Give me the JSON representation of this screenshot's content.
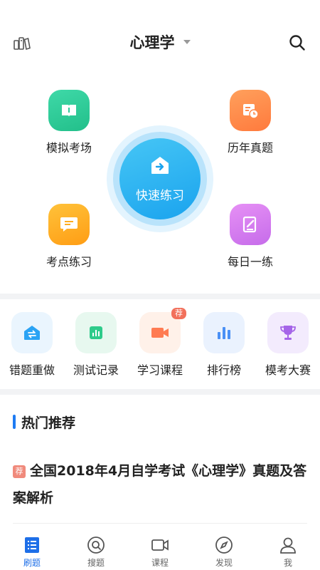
{
  "header": {
    "title": "心理学",
    "left_icon": "books-icon",
    "right_icon": "search-icon"
  },
  "quick": {
    "center_label": "快速练习",
    "items": [
      {
        "label": "模拟考场",
        "icon": "book-icon",
        "color": "#2ecb9a"
      },
      {
        "label": "历年真题",
        "icon": "calendar-clock-icon",
        "color": "#ff8a4c"
      },
      {
        "label": "考点练习",
        "icon": "chat-icon",
        "color": "#ffad1f"
      },
      {
        "label": "每日一练",
        "icon": "note-pen-icon",
        "color": "#d87df0"
      }
    ]
  },
  "tools": {
    "items": [
      {
        "label": "错题重做",
        "icon": "redo-icon",
        "color": "#2ba3f4"
      },
      {
        "label": "测试记录",
        "icon": "chart-icon",
        "color": "#2ecb8a"
      },
      {
        "label": "学习课程",
        "icon": "video-icon",
        "color": "#ff7b52",
        "badge": "荐"
      },
      {
        "label": "排行榜",
        "icon": "bar-chart-icon",
        "color": "#4a90f5"
      },
      {
        "label": "模考大赛",
        "icon": "trophy-icon",
        "color": "#a565e8"
      }
    ]
  },
  "recommend": {
    "title": "热门推荐",
    "article": {
      "tag": "荐",
      "title": "全国2018年4月自学考试《心理学》真题及答案解析"
    }
  },
  "nav": {
    "items": [
      {
        "label": "刷题",
        "icon": "list-icon",
        "active": true
      },
      {
        "label": "搜题",
        "icon": "search-circle-icon",
        "active": false
      },
      {
        "label": "课程",
        "icon": "video-icon",
        "active": false
      },
      {
        "label": "发现",
        "icon": "compass-icon",
        "active": false
      },
      {
        "label": "我",
        "icon": "user-icon",
        "active": false
      }
    ],
    "active_color": "#1e6fe8"
  }
}
